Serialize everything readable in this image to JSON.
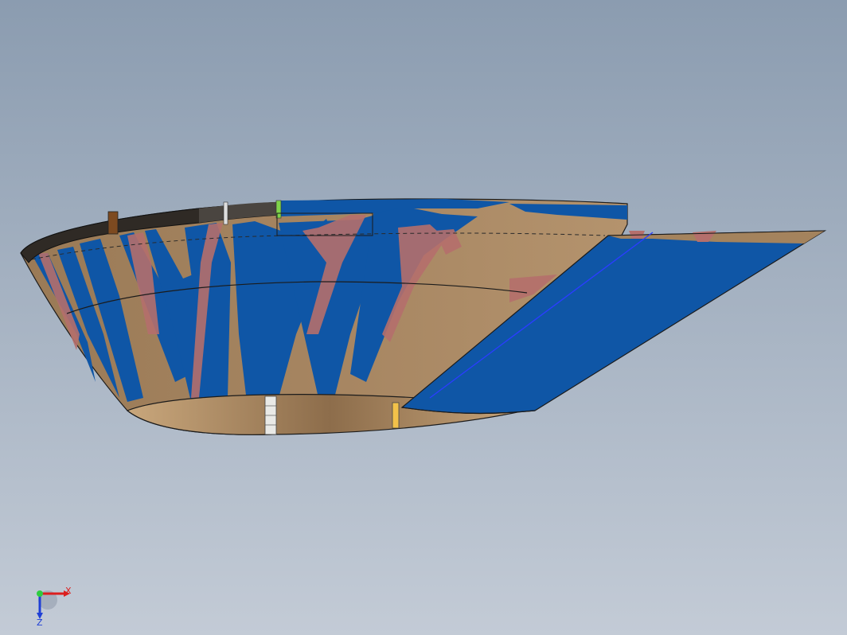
{
  "viewport": {
    "background_top": "#8b9cb0",
    "background_bottom": "#c3cbd6"
  },
  "model": {
    "surface_tan": "#a4835d",
    "surface_tan_light": "#b79570",
    "surface_tan_dark": "#7c6246",
    "deviation_blue": "#0f56a6",
    "deviation_pink": "#b56f6c",
    "rim_dark": "#2f2a25",
    "bottom_opening_inner": "#c4a078"
  },
  "triad": {
    "x_label": "X",
    "z_label": "Z",
    "x_color": "#dc1e1e",
    "y_color": "#2ecc40",
    "z_color": "#1f3fd6"
  }
}
